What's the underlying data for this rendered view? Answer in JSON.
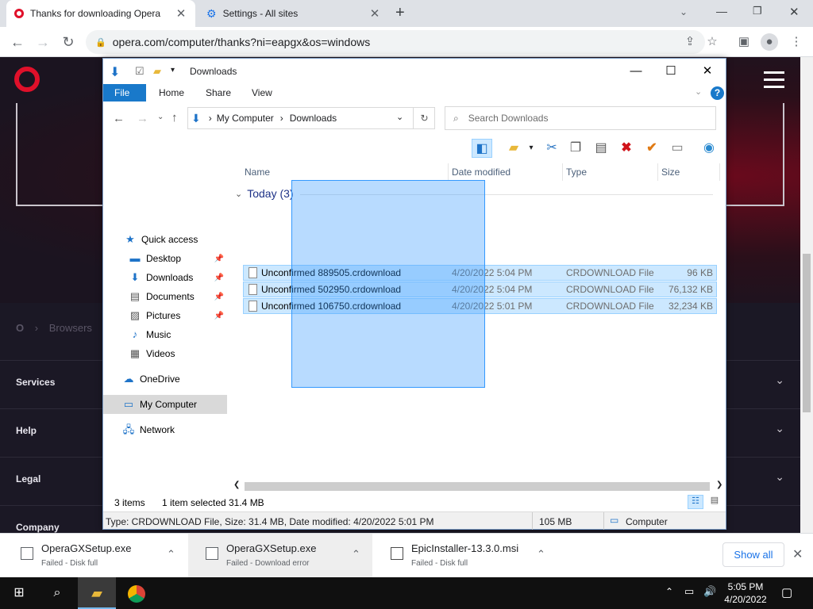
{
  "browser": {
    "tabs": [
      {
        "title": "Thanks for downloading Opera",
        "icon": "opera-icon",
        "active": true
      },
      {
        "title": "Settings - All sites",
        "icon": "gear-icon",
        "active": false
      }
    ],
    "new_tab": "+",
    "url": "opera.com/computer/thanks?ni=eapgx&os=windows"
  },
  "opera_page": {
    "footer": [
      "Services",
      "Help",
      "Legal",
      "Company"
    ],
    "breadcrumb": "Browsers"
  },
  "explorer": {
    "title": "Downloads",
    "ribbon_tabs": [
      "File",
      "Home",
      "Share",
      "View"
    ],
    "help": "?",
    "path": [
      "My Computer",
      "Downloads"
    ],
    "search_placeholder": "Search Downloads",
    "nav": [
      {
        "label": "Quick access",
        "icon": "star-icon",
        "pinned": false
      },
      {
        "label": "Desktop",
        "icon": "desktop-icon",
        "pinned": true
      },
      {
        "label": "Downloads",
        "icon": "download-icon",
        "pinned": true
      },
      {
        "label": "Documents",
        "icon": "documents-icon",
        "pinned": true
      },
      {
        "label": "Pictures",
        "icon": "pictures-icon",
        "pinned": true
      },
      {
        "label": "Music",
        "icon": "music-icon",
        "pinned": false
      },
      {
        "label": "Videos",
        "icon": "videos-icon",
        "pinned": false
      },
      {
        "label": "OneDrive",
        "icon": "cloud-icon",
        "pinned": false
      },
      {
        "label": "My Computer",
        "icon": "computer-icon",
        "pinned": false,
        "selected": true
      },
      {
        "label": "Network",
        "icon": "network-icon",
        "pinned": false
      }
    ],
    "columns": [
      "Name",
      "Date modified",
      "Type",
      "Size"
    ],
    "group": "Today (3)",
    "files": [
      {
        "name": "Unconfirmed 889505.crdownload",
        "date": "4/20/2022 5:04 PM",
        "type": "CRDOWNLOAD File",
        "size": "96 KB"
      },
      {
        "name": "Unconfirmed 502950.crdownload",
        "date": "4/20/2022 5:04 PM",
        "type": "CRDOWNLOAD File",
        "size": "76,132 KB"
      },
      {
        "name": "Unconfirmed 106750.crdownload",
        "date": "4/20/2022 5:01 PM",
        "type": "CRDOWNLOAD File",
        "size": "32,234 KB"
      }
    ],
    "status": {
      "items": "3 items",
      "selected": "1 item selected",
      "sel_size": "31.4 MB"
    },
    "details": {
      "info": "Type: CRDOWNLOAD File, Size: 31.4 MB, Date modified: 4/20/2022 5:01 PM",
      "size": "105 MB",
      "location": "Computer"
    }
  },
  "downloads_shelf": {
    "items": [
      {
        "name": "OperaGXSetup.exe",
        "status": "Failed - Disk full"
      },
      {
        "name": "OperaGXSetup.exe",
        "status": "Failed - Download error"
      },
      {
        "name": "EpicInstaller-13.3.0.msi",
        "status": "Failed - Disk full"
      }
    ],
    "show_all": "Show all"
  },
  "taskbar": {
    "time": "5:05 PM",
    "date": "4/20/2022"
  }
}
